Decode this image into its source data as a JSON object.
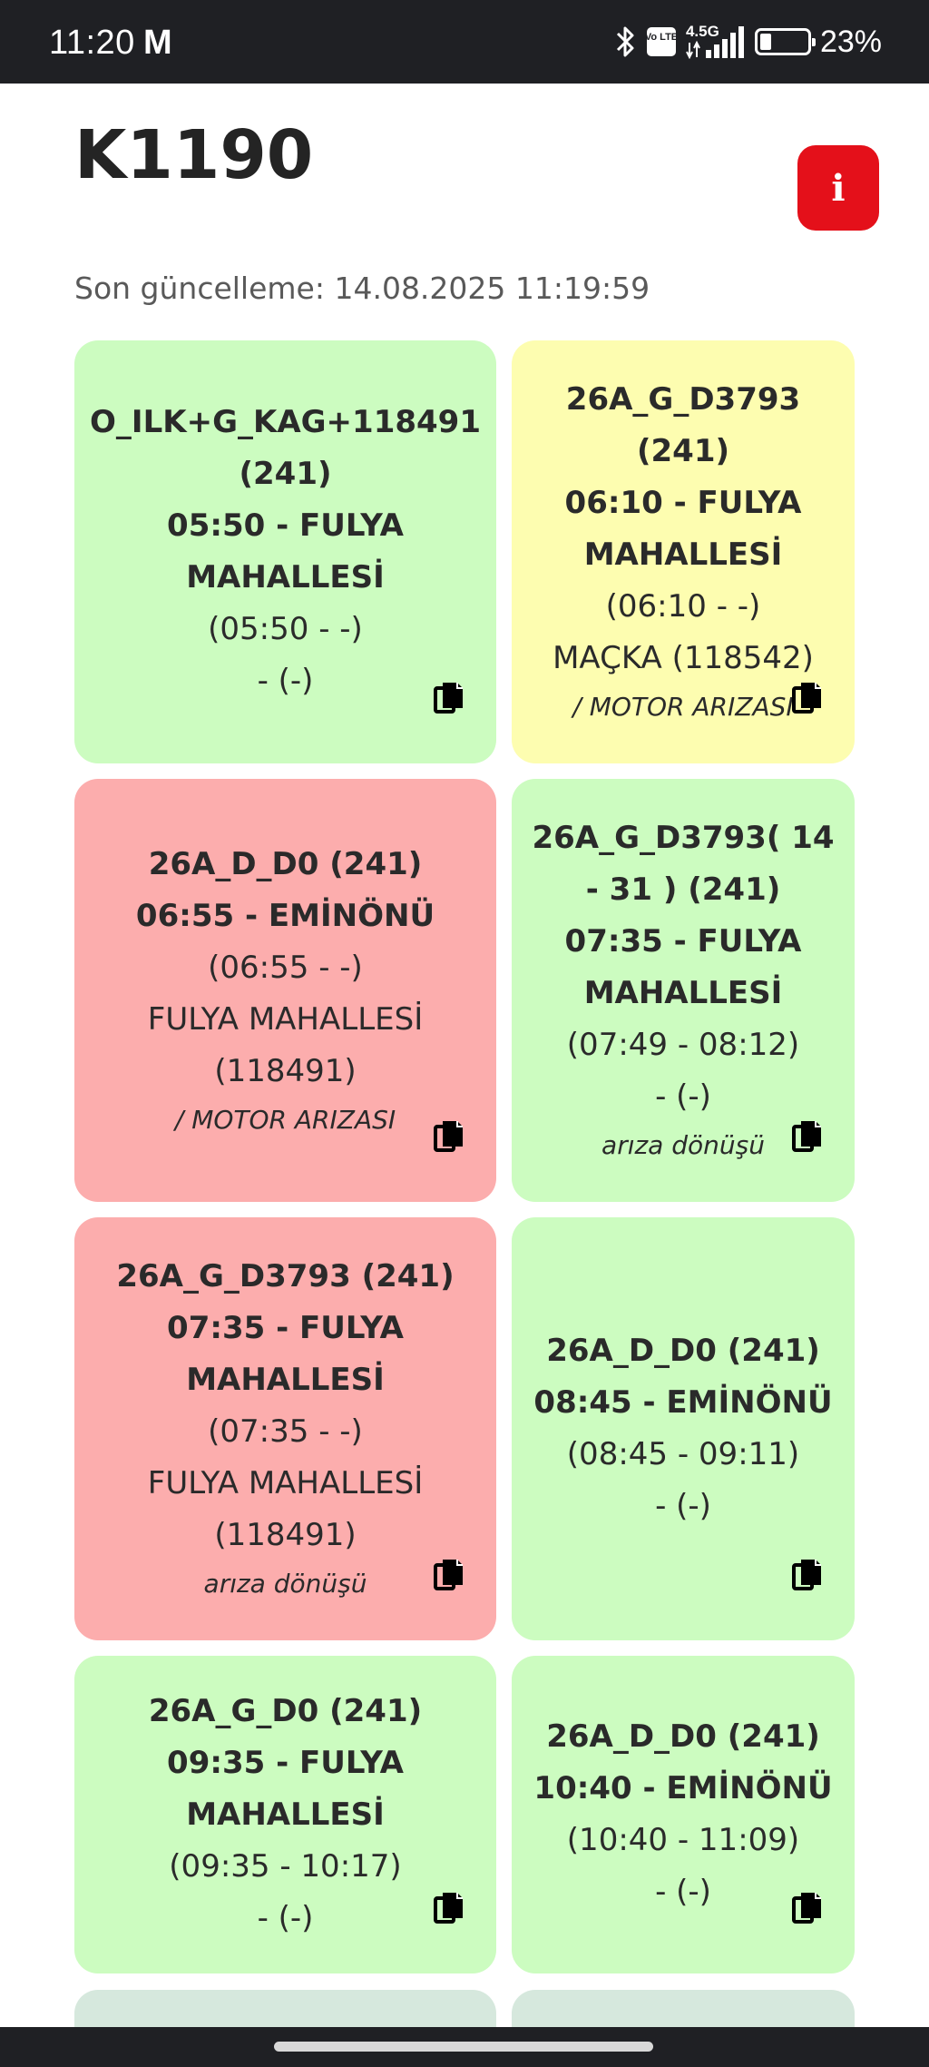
{
  "status_bar": {
    "time": "11:20",
    "notification_icon": "M",
    "battery_percent": "23%",
    "battery_level": 0.23,
    "icons": [
      "bluetooth-icon",
      "volte-icon",
      "signal-4g-icon",
      "battery-icon"
    ],
    "network_label": "4.5G",
    "volte_label": "Vo LTE"
  },
  "header": {
    "title": "K1190",
    "info_label": "i",
    "info_color": "#e4101a"
  },
  "last_updated": "Son güncelleme: 14.08.2025 11:19:59",
  "colors": {
    "green": "#ccfcc0",
    "yellow": "#fdfdb0",
    "red": "#fcadad"
  },
  "cards": [
    {
      "status": "green",
      "lines": [
        "O_ILK+G_KAG+118491",
        "(241)",
        "05:50 - FULYA",
        "MAHALLESİ"
      ],
      "regular": [
        "(05:50 - -)",
        "- (-)"
      ],
      "note": ""
    },
    {
      "status": "yellow",
      "lines": [
        "26A_G_D3793",
        "(241)",
        "06:10 - FULYA",
        "MAHALLESİ"
      ],
      "regular": [
        "(06:10 - -)",
        "MAÇKA (118542)"
      ],
      "note": "/ MOTOR ARIZASI"
    },
    {
      "status": "red",
      "lines": [
        "26A_D_D0 (241)",
        "06:55 - EMİNÖNÜ"
      ],
      "regular": [
        "(06:55 - -)",
        "FULYA MAHALLESİ",
        "(118491)"
      ],
      "note": "/ MOTOR ARIZASI"
    },
    {
      "status": "green",
      "lines": [
        "26A_G_D3793( 14",
        "- 31 ) (241)",
        "07:35 - FULYA",
        "MAHALLESİ"
      ],
      "regular": [
        "(07:49 - 08:12)",
        "- (-)"
      ],
      "note": "arıza dönüşü"
    },
    {
      "status": "red",
      "lines": [
        "26A_G_D3793 (241)",
        "07:35 - FULYA",
        "MAHALLESİ"
      ],
      "regular": [
        "(07:35 - -)",
        "FULYA MAHALLESİ",
        "(118491)"
      ],
      "note": "arıza dönüşü"
    },
    {
      "status": "green",
      "lines": [
        "26A_D_D0 (241)",
        "08:45 - EMİNÖNÜ"
      ],
      "regular": [
        "(08:45 - 09:11)",
        "- (-)"
      ],
      "note": ""
    },
    {
      "status": "green",
      "lines": [
        "26A_G_D0 (241)",
        "09:35 - FULYA",
        "MAHALLESİ"
      ],
      "regular": [
        "(09:35 - 10:17)",
        "- (-)"
      ],
      "note": ""
    },
    {
      "status": "green",
      "lines": [
        "26A_D_D0 (241)",
        "10:40 - EMİNÖNÜ"
      ],
      "regular": [
        "(10:40 - 11:09)",
        "- (-)"
      ],
      "note": ""
    }
  ]
}
